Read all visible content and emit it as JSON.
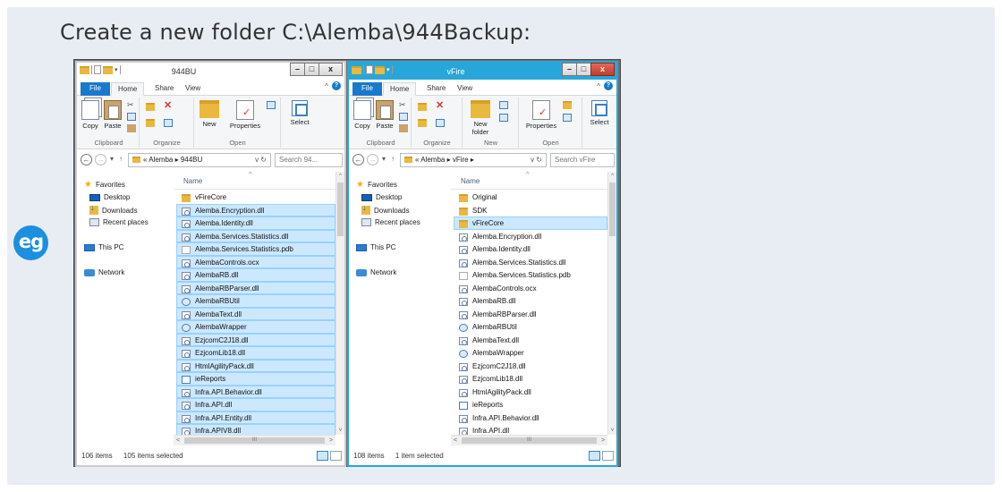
{
  "heading": "Create a new folder C:\\Alemba\\944Backup:",
  "badge": "eg",
  "left_window": {
    "title": "944BU",
    "tabs": [
      "File",
      "Home",
      "Share",
      "View"
    ],
    "ribbon": {
      "copy": "Copy",
      "paste": "Paste",
      "new": "New",
      "properties": "Properties",
      "select": "Select",
      "groups": [
        "Clipboard",
        "Organize",
        "Open"
      ]
    },
    "breadcrumb": "« Alemba ▸ 944BU",
    "search_placeholder": "Search 94...",
    "column_header": "Name",
    "nav": [
      "Favorites",
      "Desktop",
      "Downloads",
      "Recent places",
      "This PC",
      "Network"
    ],
    "files": [
      {
        "name": "vFireCore",
        "type": "folder",
        "selected": false
      },
      {
        "name": "Alemba.Encryption.dll",
        "type": "dll",
        "selected": true
      },
      {
        "name": "Alemba.Identity.dll",
        "type": "dll",
        "selected": true
      },
      {
        "name": "Alemba.Services.Statistics.dll",
        "type": "dll",
        "selected": true
      },
      {
        "name": "Alemba.Services.Statistics.pdb",
        "type": "doc",
        "selected": true
      },
      {
        "name": "AlembaControls.ocx",
        "type": "dll",
        "selected": true
      },
      {
        "name": "AlembaRB.dll",
        "type": "dll",
        "selected": true
      },
      {
        "name": "AlembaRBParser.dll",
        "type": "dll",
        "selected": true
      },
      {
        "name": "AlembaRBUtil",
        "type": "app",
        "selected": true
      },
      {
        "name": "AlembaText.dll",
        "type": "dll",
        "selected": true
      },
      {
        "name": "AlembaWrapper",
        "type": "app",
        "selected": true
      },
      {
        "name": "EzjcomC2J18.dll",
        "type": "dll",
        "selected": true
      },
      {
        "name": "EzjcomLib18.dll",
        "type": "dll",
        "selected": true
      },
      {
        "name": "HtmlAgilityPack.dll",
        "type": "dll",
        "selected": true
      },
      {
        "name": "ieReports",
        "type": "rep",
        "selected": true
      },
      {
        "name": "Infra.API.Behavior.dll",
        "type": "dll",
        "selected": true
      },
      {
        "name": "Infra.API.dll",
        "type": "dll",
        "selected": true
      },
      {
        "name": "Infra.API.Entity.dll",
        "type": "dll",
        "selected": true
      },
      {
        "name": "Infra.APIV8.dll",
        "type": "dll",
        "selected": true
      }
    ],
    "status_count": "106 items",
    "status_selected": "105 items selected"
  },
  "right_window": {
    "title": "vFire",
    "tabs": [
      "File",
      "Home",
      "Share",
      "View"
    ],
    "ribbon": {
      "copy": "Copy",
      "paste": "Paste",
      "new_folder": "New folder",
      "properties": "Properties",
      "select": "Select",
      "groups": [
        "Clipboard",
        "Organize",
        "New",
        "Open"
      ]
    },
    "breadcrumb": "« Alemba ▸ vFire ▸",
    "search_placeholder": "Search vFire",
    "column_header": "Name",
    "nav": [
      "Favorites",
      "Desktop",
      "Downloads",
      "Recent places",
      "This PC",
      "Network"
    ],
    "files": [
      {
        "name": "Original",
        "type": "folder",
        "selected": false
      },
      {
        "name": "SDK",
        "type": "folder",
        "selected": false
      },
      {
        "name": "vFireCore",
        "type": "folder",
        "selected": true
      },
      {
        "name": "Alemba.Encryption.dll",
        "type": "dll",
        "selected": false
      },
      {
        "name": "Alemba.Identity.dll",
        "type": "dll",
        "selected": false
      },
      {
        "name": "Alemba.Services.Statistics.dll",
        "type": "dll",
        "selected": false
      },
      {
        "name": "Alemba.Services.Statistics.pdb",
        "type": "doc",
        "selected": false
      },
      {
        "name": "AlembaControls.ocx",
        "type": "dll",
        "selected": false
      },
      {
        "name": "AlembaRB.dll",
        "type": "dll",
        "selected": false
      },
      {
        "name": "AlembaRBParser.dll",
        "type": "dll",
        "selected": false
      },
      {
        "name": "AlembaRBUtil",
        "type": "app",
        "selected": false
      },
      {
        "name": "AlembaText.dll",
        "type": "dll",
        "selected": false
      },
      {
        "name": "AlembaWrapper",
        "type": "app",
        "selected": false
      },
      {
        "name": "EzjcomC2J18.dll",
        "type": "dll",
        "selected": false
      },
      {
        "name": "EzjcomLib18.dll",
        "type": "dll",
        "selected": false
      },
      {
        "name": "HtmlAgilityPack.dll",
        "type": "dll",
        "selected": false
      },
      {
        "name": "ieReports",
        "type": "rep",
        "selected": false
      },
      {
        "name": "Infra.API.Behavior.dll",
        "type": "dll",
        "selected": false
      },
      {
        "name": "Infra.API.dll",
        "type": "dll",
        "selected": false
      }
    ],
    "status_count": "108 items",
    "status_selected": "1 item selected"
  },
  "colors": {
    "accent": "#1979ca",
    "active_title": "#29a6d9",
    "selection": "#cce8ff",
    "badge": "#1b8fe0"
  }
}
